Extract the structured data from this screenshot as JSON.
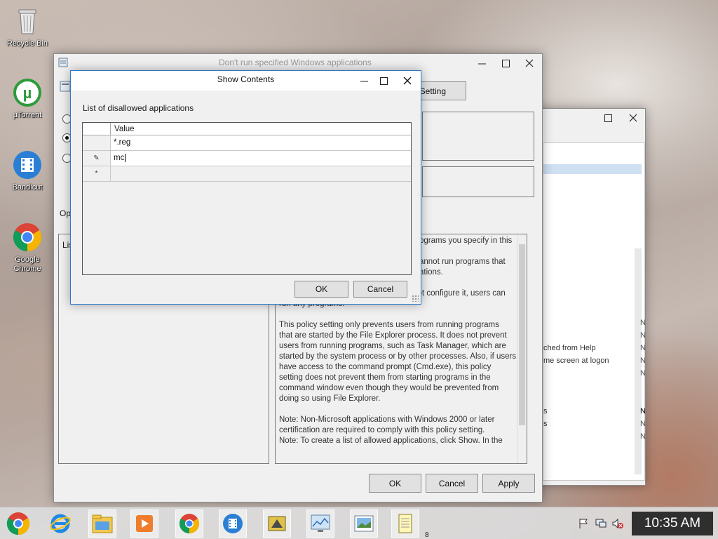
{
  "desktop": {
    "icons": [
      {
        "label": "Recycle Bin"
      },
      {
        "label": "µTorrent"
      },
      {
        "label": "Bandicut"
      },
      {
        "label": "Google Chrome"
      }
    ]
  },
  "policy_window": {
    "title": "Don't run specified Windows applications",
    "next_setting_label": "t Setting",
    "options_label": "Op",
    "list_label": "Lis",
    "help": [
      "ograms you specify in this",
      "annot run programs that\nations.",
      "If you disable this policy setting or do not configure it, users can\nrun any programs.",
      "This policy setting only prevents users from running programs\nthat are started by the File Explorer process. It does not prevent\nusers from running programs, such as Task Manager, which are\nstarted by the system process or by other processes.  Also, if users\nhave access to the command prompt (Cmd.exe), this policy\nsetting does not prevent them from starting programs in the\ncommand window even though they would be prevented from\ndoing so using File Explorer.",
      "Note: Non-Microsoft applications with Windows 2000 or later\ncertification are required to comply with this policy setting.\nNote: To create a list of allowed applications, click Show.  In the"
    ],
    "ok_label": "OK",
    "cancel_label": "Cancel",
    "apply_label": "Apply"
  },
  "background_window": {
    "items": [
      {
        "text": "ched from Help",
        "state": "N"
      },
      {
        "text": "me screen at logon",
        "state": "N"
      },
      {
        "text": "s",
        "state": "N"
      },
      {
        "text": "s",
        "state": "N"
      }
    ],
    "states": [
      "N",
      "N",
      "N",
      "N",
      "N",
      "N",
      "N"
    ]
  },
  "show_contents": {
    "title": "Show Contents",
    "list_label": "List of disallowed applications",
    "column_header": "Value",
    "rows": [
      {
        "marker": "",
        "value": "*.reg"
      },
      {
        "marker": "✎",
        "value": "mc"
      },
      {
        "marker": "*",
        "value": ""
      }
    ],
    "ok_label": "OK",
    "cancel_label": "Cancel"
  },
  "taskbar": {
    "clock": "10:35 AM",
    "badge": "8"
  },
  "colors": {
    "accent": "#2b78c5",
    "clock_bg": "#2f2f2f",
    "selection": "#cfe0f3"
  }
}
